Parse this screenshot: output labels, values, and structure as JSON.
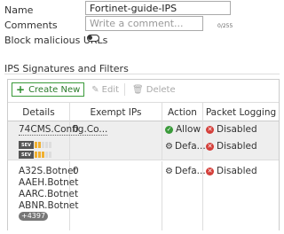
{
  "form": {
    "name_label": "Name",
    "name_value": "Fortinet-guide-IPS",
    "comments_label": "Comments",
    "comments_placeholder": "Write a comment...",
    "comments_counter": "0/255",
    "block_label": "Block malicious URLs",
    "block_enabled": false
  },
  "section": {
    "title": "IPS Signatures and Filters"
  },
  "toolbar": {
    "create_label": "Create New",
    "edit_label": "Edit",
    "delete_label": "Delete"
  },
  "table": {
    "headers": [
      "Details",
      "Exempt IPs",
      "Action",
      "Packet Logging"
    ],
    "rows": [
      {
        "details": "74CMS.Config.Co...",
        "exempt": "0",
        "action": "Allow",
        "logging": "Disabled",
        "sub": {
          "sev_label": "SEV",
          "sev2_label": "SEV",
          "action": "Defa...",
          "logging": "Disabled"
        }
      },
      {
        "details_lines": [
          "A32S.Botnet",
          "AAEH.Botnet",
          "AARC.Botnet",
          "ABNR.Botnet"
        ],
        "more": "+4397",
        "exempt": "0",
        "action": "Defa...",
        "logging": "Disabled"
      }
    ]
  },
  "colors": {
    "allow": "#3a9a3a",
    "disabled": "#d43f3a",
    "severity": "#f0b030",
    "create_border": "#3a9a3a"
  }
}
